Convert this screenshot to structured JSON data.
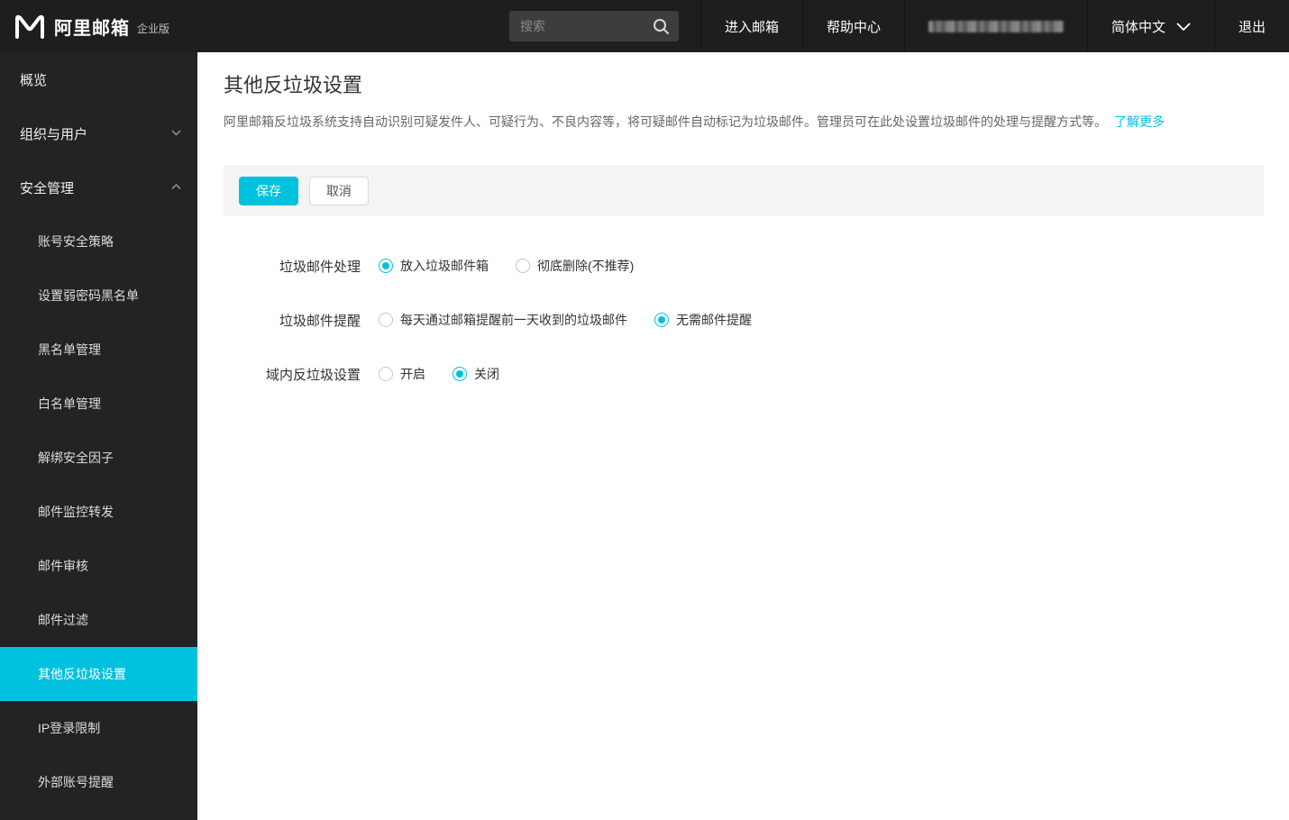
{
  "colors": {
    "accent": "#00c1de",
    "topbar_bg": "#1e1e1e",
    "sidebar_bg": "#232323"
  },
  "topbar": {
    "brand_name": "阿里邮箱",
    "brand_edition": "企业版",
    "search_placeholder": "搜索",
    "nav_enter_mail": "进入邮箱",
    "nav_help_center": "帮助中心",
    "nav_language": "简体中文",
    "nav_logout": "退出"
  },
  "sidebar": {
    "items": [
      {
        "label": "概览"
      },
      {
        "label": "组织与用户"
      },
      {
        "label": "安全管理"
      }
    ],
    "security_sub_items": [
      "账号安全策略",
      "设置弱密码黑名单",
      "黑名单管理",
      "白名单管理",
      "解绑安全因子",
      "邮件监控转发",
      "邮件审核",
      "邮件过滤",
      "其他反垃圾设置",
      "IP登录限制",
      "外部账号提醒"
    ],
    "active_sub_item": "其他反垃圾设置"
  },
  "main": {
    "title": "其他反垃圾设置",
    "description": "阿里邮箱反垃圾系统支持自动识别可疑发件人、可疑行为、不良内容等，将可疑邮件自动标记为垃圾邮件。管理员可在此处设置垃圾邮件的处理与提醒方式等。",
    "learn_more": "了解更多",
    "save_label": "保存",
    "cancel_label": "取消",
    "form": [
      {
        "label": "垃圾邮件处理",
        "options": [
          {
            "label": "放入垃圾邮件箱",
            "selected": true
          },
          {
            "label": "彻底删除(不推荐)",
            "selected": false
          }
        ]
      },
      {
        "label": "垃圾邮件提醒",
        "options": [
          {
            "label": "每天通过邮箱提醒前一天收到的垃圾邮件",
            "selected": false
          },
          {
            "label": "无需邮件提醒",
            "selected": true
          }
        ]
      },
      {
        "label": "域内反垃圾设置",
        "options": [
          {
            "label": "开启",
            "selected": false
          },
          {
            "label": "关闭",
            "selected": true
          }
        ]
      }
    ]
  }
}
